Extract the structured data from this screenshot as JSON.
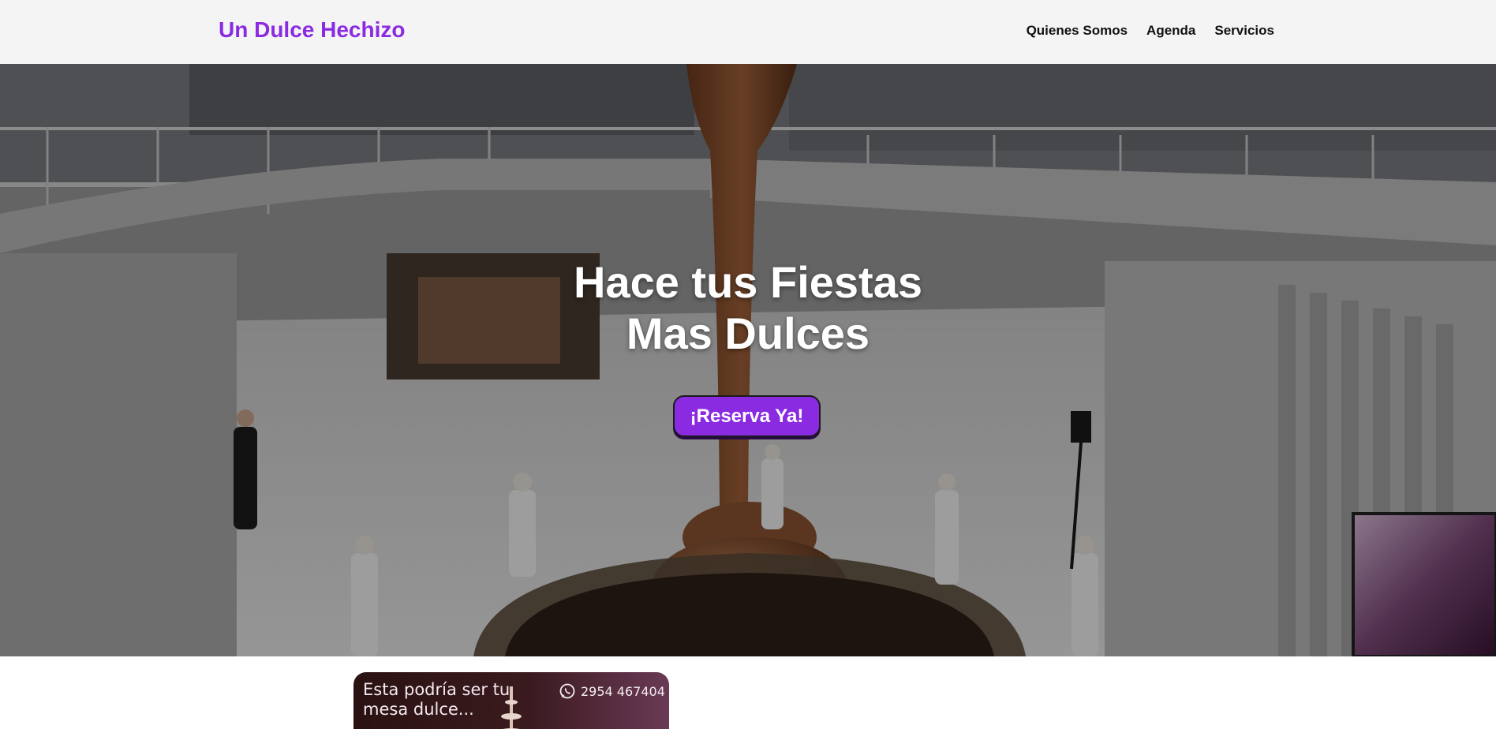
{
  "navbar": {
    "brand": "Un Dulce Hechizo",
    "links": [
      "Quienes Somos",
      "Agenda",
      "Servicios"
    ]
  },
  "hero": {
    "title_line1": "Hace tus Fiestas",
    "title_line2": "Mas Dulces",
    "cta_label": "¡Reserva Ya!"
  },
  "promo": {
    "line1": "Esta podría ser tu",
    "line2": "mesa dulce...",
    "phone": "2954 467404",
    "phone_icon": "whatsapp-icon"
  },
  "colors": {
    "brand": "#8a2be2",
    "navbar_bg": "#f4f4f4",
    "cta_bg": "#8a2be2"
  }
}
